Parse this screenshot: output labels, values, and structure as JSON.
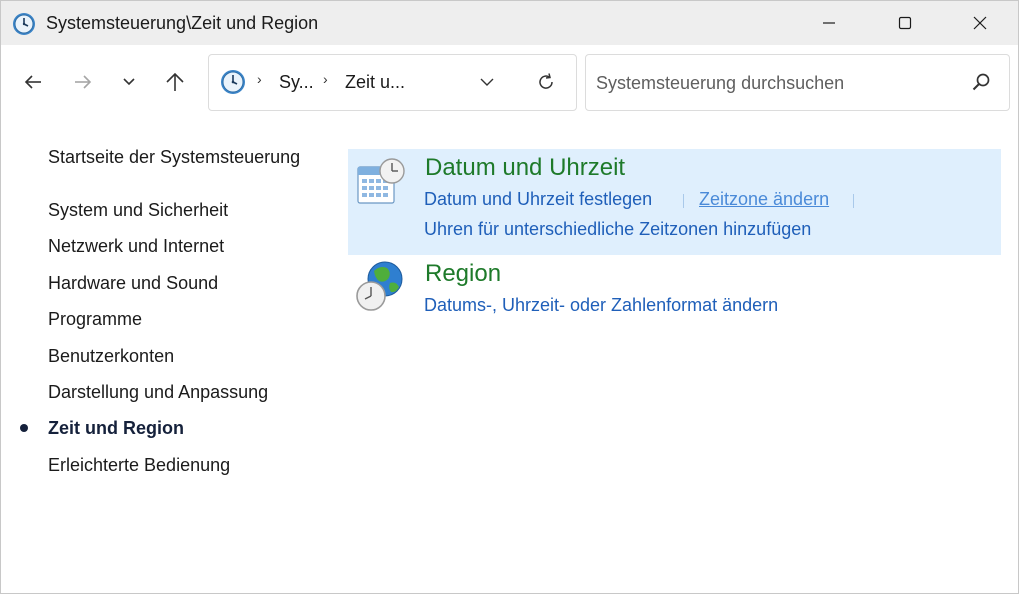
{
  "window": {
    "title": "Systemsteuerung\\Zeit und Region",
    "controls": {
      "minimize": "minimize-icon",
      "maximize": "maximize-icon",
      "close": "close-icon"
    }
  },
  "navigation": {
    "back_icon": "arrow-left-icon",
    "forward_icon": "arrow-right-icon",
    "recent_icon": "chevron-down-icon",
    "up_icon": "arrow-up-icon",
    "address": {
      "separator": "›",
      "crumbs": [
        "Sy...",
        "Zeit u..."
      ]
    },
    "search": {
      "placeholder": "Systemsteuerung durchsuchen",
      "value": ""
    }
  },
  "sidebar": {
    "items": [
      {
        "label": "Startseite der Systemsteuerung"
      },
      {
        "label": "System und Sicherheit"
      },
      {
        "label": "Netzwerk und Internet"
      },
      {
        "label": "Hardware und Sound"
      },
      {
        "label": "Programme"
      },
      {
        "label": "Benutzerkonten"
      },
      {
        "label": "Darstellung und Anpassung"
      },
      {
        "label": "Zeit und Region"
      },
      {
        "label": "Erleichterte Bedienung"
      }
    ],
    "active_index": 7
  },
  "categories": [
    {
      "title": "Datum und Uhrzeit",
      "icon": "calendar-clock-icon",
      "links": [
        "Datum und Uhrzeit festlegen",
        "Zeitzone ändern",
        "Uhren für unterschiedliche Zeitzonen hinzufügen"
      ]
    },
    {
      "title": "Region",
      "icon": "globe-clock-icon",
      "links": [
        "Datums-, Uhrzeit- oder Zahlenformat ändern"
      ]
    }
  ],
  "colors": {
    "category_title": "#1e7a2a",
    "link": "#1f5fb9",
    "highlight": "#dfeffd",
    "titlebar": "#eeeeee"
  }
}
